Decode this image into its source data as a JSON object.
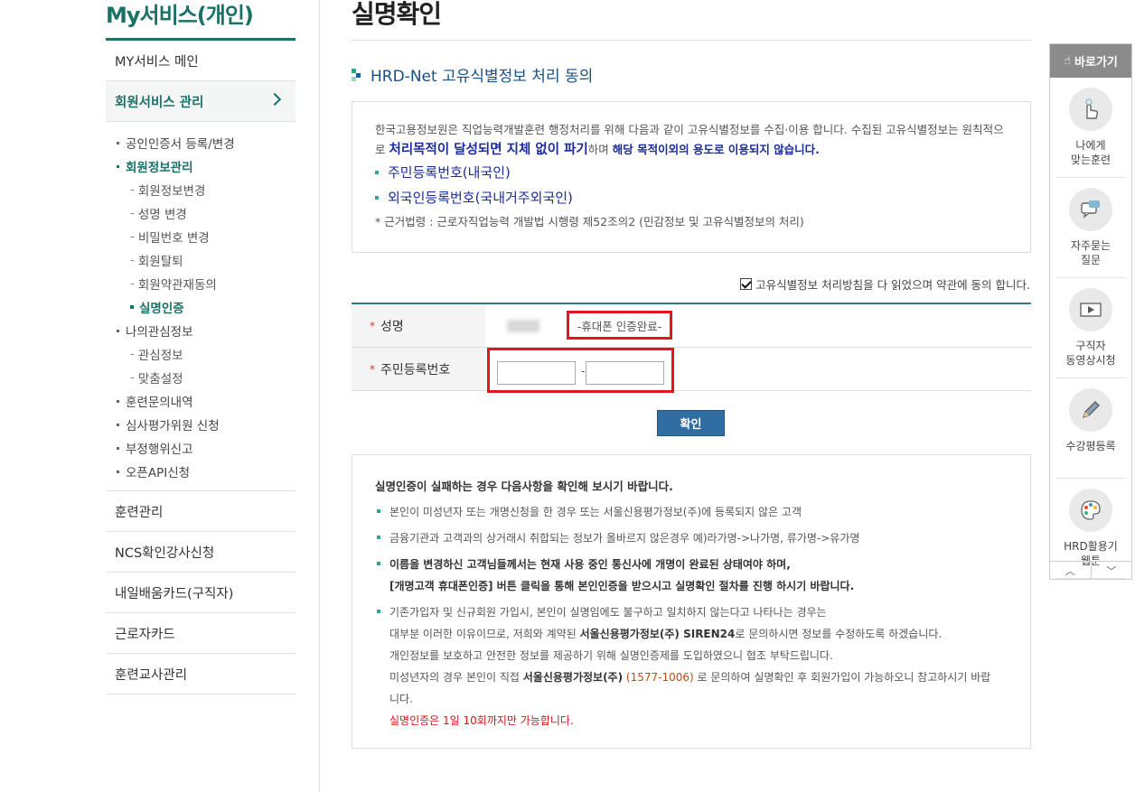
{
  "sidebar": {
    "title": "My서비스(개인)",
    "items": [
      {
        "label": "MY서비스 메인"
      },
      {
        "label": "회원서비스 관리"
      }
    ],
    "sub": {
      "cert": "공인인증서 등록/변경",
      "member_info": "회원정보관리",
      "member_info_children": [
        "회원정보변경",
        "성명 변경",
        "비밀번호 변경",
        "회원탈퇴",
        "회원약관재동의",
        "실명인증"
      ],
      "interest": "나의관심정보",
      "interest_children": [
        "관심정보",
        "맞춤설정"
      ],
      "inquiry": "훈련문의내역",
      "review_committee": "심사평가위원 신청",
      "fraud_report": "부정행위신고",
      "open_api": "오픈API신청"
    },
    "bottom_items": [
      "훈련관리",
      "NCS확인강사신청",
      "내일배움카드(구직자)",
      "근로자카드",
      "훈련교사관리"
    ]
  },
  "main": {
    "page_title": "실명확인",
    "section_title": "HRD-Net 고유식별정보 처리 동의",
    "info": {
      "text1": "한국고용정보원은 직업능력개발훈련 행정처리를 위해 다음과 같이 고유식별정보를 수집·이용 합니다. 수집된 고유식별정보는 원칙적으",
      "text2_prefix": "로 ",
      "text2_big": "처리목적이 달성되면 지체 없이 파기",
      "text2_mid": "하며 ",
      "text2_blue": "해당 목적이외의 용도로 이용되지 않습니다.",
      "id_items": [
        "주민등록번호(내국인)",
        "외국인등록번호(국내거주외국인)"
      ],
      "note": "* 근거법령 : 근로자직업능력 개발법 시행령 제52조의2 (민감정보 및 고유식별정보의 처리)"
    },
    "agree_text": "고유식별정보 처리방침을 다 읽었으며 약관에 동의 합니다.",
    "form": {
      "name_label": "성명",
      "name_status": "-휴대폰 인증완료-",
      "ssn_label": "주민등록번호",
      "ssn_dash": "-",
      "required_mark": "*"
    },
    "confirm_button": "확인",
    "notice": {
      "head": "실명인증이 실패하는 경우 다음사항을 확인해 보시기 바랍니다.",
      "item1": "본인이 미성년자 또는 개명신청을 한 경우 또는 서울신용평가정보(주)에 등록되지 않은 고객",
      "item2": "금융기관과 고객과의 상거래시 취합되는 정보가 올바르지 않은경우 예)라가명->나가명, 류가명->유가명",
      "item3_line1": "이름을 변경하신 고객님들께서는 현재 사용 중인 통신사에 개명이 완료된 상태여야 하며,",
      "item3_line2": "[개명고객 휴대폰인증] 버튼 클릭을 통해 본인인증을 받으시고 실명확인 절차를 진행 하시기 바랍니다.",
      "item4_line1": "기존가입자 및 신규회원 가입시, 본인이 실명임에도 불구하고 일치하지 않는다고 나타나는 경우는",
      "item4_line2_a": "대부분 이러한 이유이므로, 저희와 계약된 ",
      "item4_line2_b": "서울신용평가정보(주) SIREN24",
      "item4_line2_c": "로 문의하시면 정보를 수정하도록 하겠습니다.",
      "item4_line3": "개인정보를 보호하고 안전한 정보를 제공하기 위해 실명인증제를 도입하였으니 협조 부탁드립니다.",
      "item4_line4_a": "미성년자의 경우 본인이 직접 ",
      "item4_line4_b": "서울신용평가정보(주)",
      "item4_line4_c": " (1577-1006)",
      "item4_line4_d": " 로 문의하여 실명확인 후 회원가입이 가능하오니 참고하시기 바랍",
      "item4_line5": "니다.",
      "item4_line6": "실명인증은 1일 10회까지만 가능합니다."
    }
  },
  "quick": {
    "title": "바로가기",
    "items": [
      {
        "label1": "나에게",
        "label2": "맞는훈련",
        "icon": "touch-hand-icon"
      },
      {
        "label1": "자주묻는",
        "label2": "질문",
        "icon": "chat-bubble-icon"
      },
      {
        "label1": "구직자",
        "label2": "동영상시청",
        "icon": "video-play-icon"
      },
      {
        "label1": "수강평등록",
        "label2": "",
        "icon": "pencil-icon"
      },
      {
        "label1": "HRD활용기",
        "label2": "웹툰",
        "icon": "palette-icon"
      }
    ],
    "up": "︿",
    "down": "﹀"
  },
  "colors": {
    "brand_green": "#1a7267",
    "navy": "#1b2a9c",
    "button_blue": "#2f6da3",
    "highlight_red": "#e8141b"
  }
}
